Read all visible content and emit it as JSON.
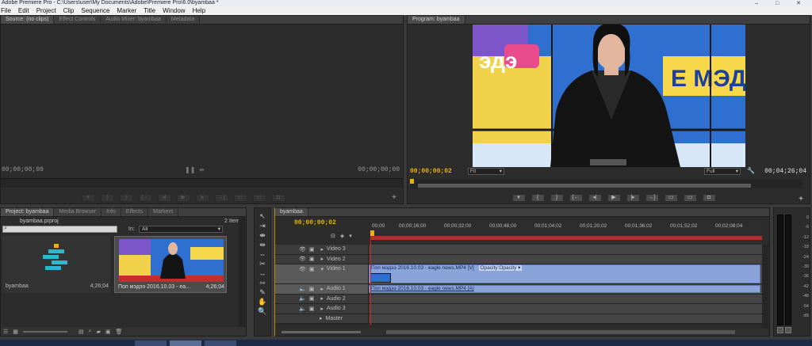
{
  "window": {
    "title": "Adobe Premiere Pro - C:\\Users\\user\\My Documents\\Adobe\\Premiere Pro\\6.0\\byambaa *",
    "controls": "– □ ✕"
  },
  "menu": [
    "File",
    "Edit",
    "Project",
    "Clip",
    "Sequence",
    "Marker",
    "Title",
    "Window",
    "Help"
  ],
  "source_panel": {
    "tabs": [
      "Source: (no clips)",
      "Effect Controls",
      "Audio Mixer: byambaa",
      "Metadata"
    ],
    "tc_left": "00;00;00;00",
    "tc_right": "00;00;00;00"
  },
  "program_panel": {
    "tab": "Program: byambaa",
    "tc_current": "00;00;00;02",
    "fit": "Fit",
    "quality": "Full",
    "tc_duration": "00;04;26;04"
  },
  "project_panel": {
    "tabs": [
      "Project: byambaa",
      "Media Browser",
      "Info",
      "Effects",
      "Markers"
    ],
    "file": "byambaa.prproj",
    "items_count": "2 Items",
    "in_label": "In:",
    "in_value": "All",
    "items": [
      {
        "name": "byambaa",
        "duration": "4;26;04"
      },
      {
        "name": "Поп мэдээ 2016.10.03 - ea...",
        "duration": "4;26;04"
      }
    ]
  },
  "timeline": {
    "tab": "byambaa",
    "tc": "00;00;00;02",
    "ruler": [
      "00;00",
      "00;00;16;00",
      "00;00;32;00",
      "00;00;48;00",
      "00;01;04;02",
      "00;01;20;02",
      "00;01;36;02",
      "00;01;52;02",
      "00;02;08;04"
    ],
    "tracks": {
      "v3": "Video 3",
      "v2": "Video 2",
      "v1": "Video 1",
      "a1": "Audio 1",
      "a2": "Audio 2",
      "a3": "Audio 3",
      "master": "Master"
    },
    "video_clip": "Поп мэдээ 2016.10.03 - eagle news.MP4 [V]",
    "opacity": "Opacity:Opacity ▾",
    "audio_clip": "Поп мэдээ 2016.10.03 - eagle news.MP4 [A]"
  },
  "meters": [
    "0",
    "-6",
    "-12",
    "-18",
    "-24",
    "-30",
    "-36",
    "-42",
    "-48",
    "-54",
    "dB"
  ],
  "colors": {
    "accent_tc": "#e8b400",
    "clip_blue": "#8aa3d8",
    "playhead": "#d22020"
  }
}
